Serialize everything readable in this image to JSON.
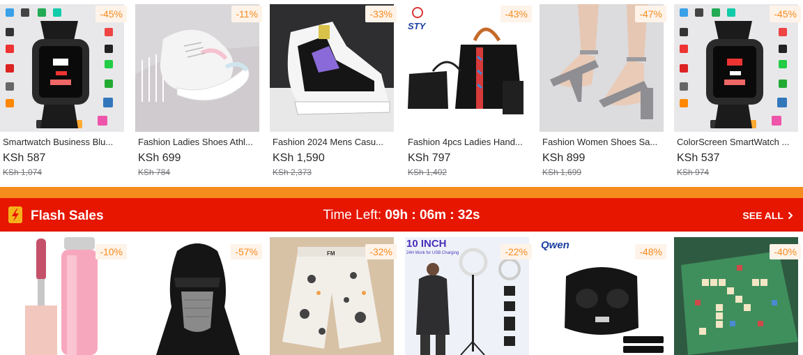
{
  "top_products": [
    {
      "name": "Smartwatch Business Blu...",
      "price": "KSh 587",
      "old_price": "KSh 1,074",
      "discount": "-45%"
    },
    {
      "name": "Fashion Ladies Shoes Athl...",
      "price": "KSh 699",
      "old_price": "KSh 784",
      "discount": "-11%"
    },
    {
      "name": "Fashion 2024 Mens Casu...",
      "price": "KSh 1,590",
      "old_price": "KSh 2,373",
      "discount": "-33%"
    },
    {
      "name": "Fashion 4pcs Ladies Hand...",
      "price": "KSh 797",
      "old_price": "KSh 1,402",
      "discount": "-43%"
    },
    {
      "name": "Fashion Women Shoes Sa...",
      "price": "KSh 899",
      "old_price": "KSh 1,699",
      "discount": "-47%"
    },
    {
      "name": "ColorScreen SmartWatch ...",
      "price": "KSh 537",
      "old_price": "KSh 974",
      "discount": "-45%"
    }
  ],
  "flash": {
    "title": "Flash Sales",
    "time_label": "Time Left:",
    "time_value": "09h : 06m : 32s",
    "see_all": "SEE ALL"
  },
  "flash_products": [
    {
      "discount": "-10%"
    },
    {
      "discount": "-57%"
    },
    {
      "discount": "-32%",
      "brand": "FM"
    },
    {
      "discount": "-22%",
      "headline": "10 INCH",
      "subline": "24H Work for USB Charging"
    },
    {
      "discount": "-48%",
      "brand": "Qwen"
    },
    {
      "discount": "-40%"
    }
  ],
  "product_texts": {
    "bag_brand": "STY"
  },
  "colors": {
    "accent": "#f68b1e",
    "flash_red": "#e61601",
    "badge_bg": "#fef3e9"
  }
}
